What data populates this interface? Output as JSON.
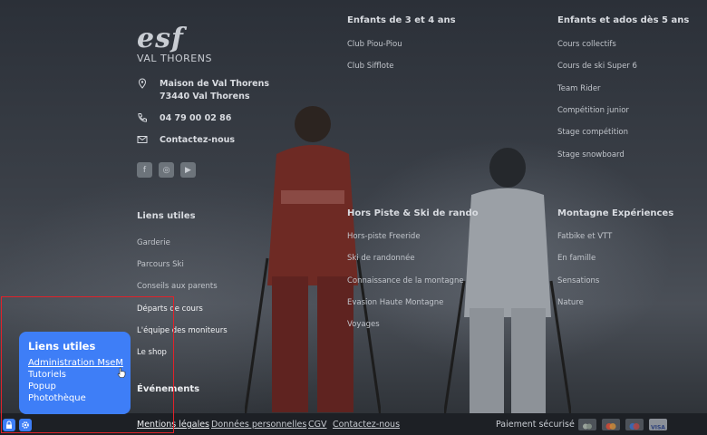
{
  "brand": {
    "logo_text": "esf",
    "subtitle": "VAL THORENS"
  },
  "contact": {
    "address_line1": "Maison de Val Thorens",
    "address_line2": "73440 Val Thorens",
    "phone": "04 79 00 02 86",
    "contact_link": "Contactez-nous"
  },
  "socials": [
    "f",
    "◎",
    "▶"
  ],
  "columns": {
    "kids": {
      "title": "Enfants de 3 et 4 ans",
      "items": [
        "Club Piou-Piou",
        "Club Sifflote"
      ]
    },
    "teens": {
      "title": "Enfants et ados dès 5 ans",
      "items": [
        "Cours collectifs",
        "Cours de ski Super 6",
        "Team Rider",
        "Compétition junior",
        "Stage compétition",
        "Stage snowboard"
      ]
    },
    "useful": {
      "title": "Liens utiles",
      "items": [
        "Garderie",
        "Parcours Ski",
        "Conseils aux parents",
        "Départs de cours",
        "L'équipe des moniteurs",
        "Le shop"
      ]
    },
    "offpiste": {
      "title": "Hors Piste & Ski de rando",
      "items": [
        "Hors-piste Freeride",
        "Ski de randonnée",
        "Connaissance de la montagne",
        "Evasion Haute Montagne",
        "Voyages"
      ]
    },
    "mountain": {
      "title": "Montagne Expériences",
      "items": [
        "Fatbike et VTT",
        "En famille",
        "Sensations",
        "Nature"
      ]
    },
    "events": {
      "title": "Événements"
    }
  },
  "footer": {
    "links": [
      "Mentions légales",
      "Données personnelles",
      "CGV",
      "Contactez-nous"
    ],
    "payment_label": "Paiement sécurisé",
    "cards": [
      "card-generic",
      "mastercard",
      "maestro",
      "visa"
    ]
  },
  "popup": {
    "title": "Liens utiles",
    "items": [
      "Administration MseM",
      "Tutoriels",
      "Popup",
      "Photothèque"
    ]
  },
  "colors": {
    "accent": "#3e7ef7",
    "highlight": "#e1222a"
  }
}
